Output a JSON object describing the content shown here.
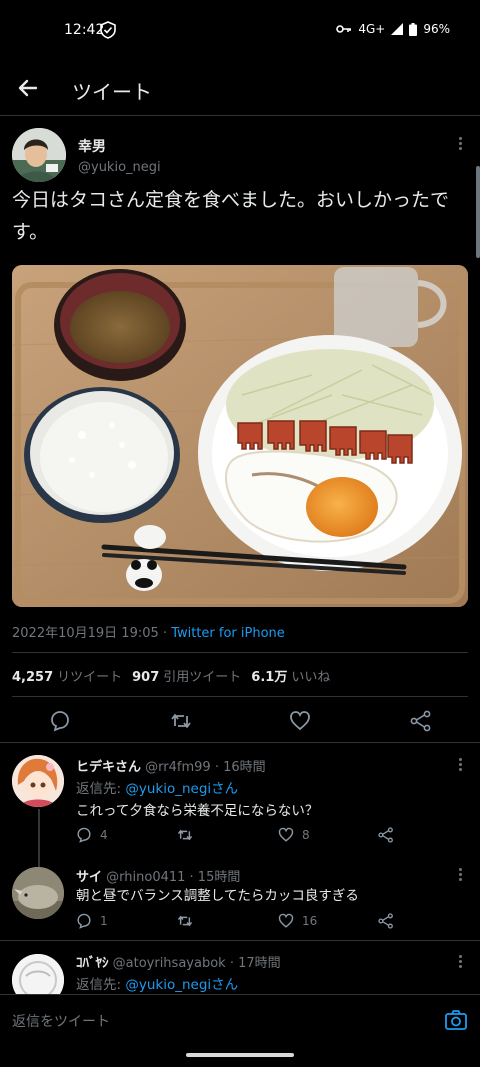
{
  "status_bar": {
    "time": "12:42",
    "network": "4G+",
    "battery": "96%"
  },
  "header": {
    "title": "ツイート"
  },
  "tweet": {
    "author_name": "幸男",
    "author_handle": "@yukio_negi",
    "text": "今日はタコさん定食を食べました。おいしかったです。",
    "timestamp": "2022年10月19日 19:05",
    "source": "Twitter for iPhone",
    "stats": {
      "retweets_count": "4,257",
      "retweets_label": "リツイート",
      "quotes_count": "907",
      "quotes_label": "引用ツイート",
      "likes_count": "6.1万",
      "likes_label": "いいね"
    },
    "actions": [
      "reply-icon",
      "retweet-icon",
      "heart-icon",
      "share-icon"
    ]
  },
  "replies": [
    {
      "name": "ヒデキさん",
      "handle": "@rr4fm99",
      "time": "· 16時間",
      "reply_to_label": "返信先:",
      "reply_to_handle": "@yukio_negiさん",
      "text": "これって夕食なら栄養不足にならない？",
      "reply_count": "4",
      "retweet_count": "",
      "like_count": "8"
    },
    {
      "name": "サイ",
      "handle": "@rhino0411",
      "time": "· 15時間",
      "text": "朝と昼でバランス調整してたらカッコ良すぎる",
      "reply_count": "1",
      "retweet_count": "",
      "like_count": "16"
    },
    {
      "name": "ｺﾊﾞﾔｼ",
      "handle": "@atoyrihsayabok",
      "time": "· 17時間",
      "reply_to_label": "返信先:",
      "reply_to_handle": "@yukio_negiさん"
    }
  ],
  "reply_bar": {
    "placeholder": "返信をツイート"
  },
  "colors": {
    "background": "#000000",
    "accent": "#1d9bf0",
    "muted": "#71767b",
    "divider": "#2f3336"
  }
}
